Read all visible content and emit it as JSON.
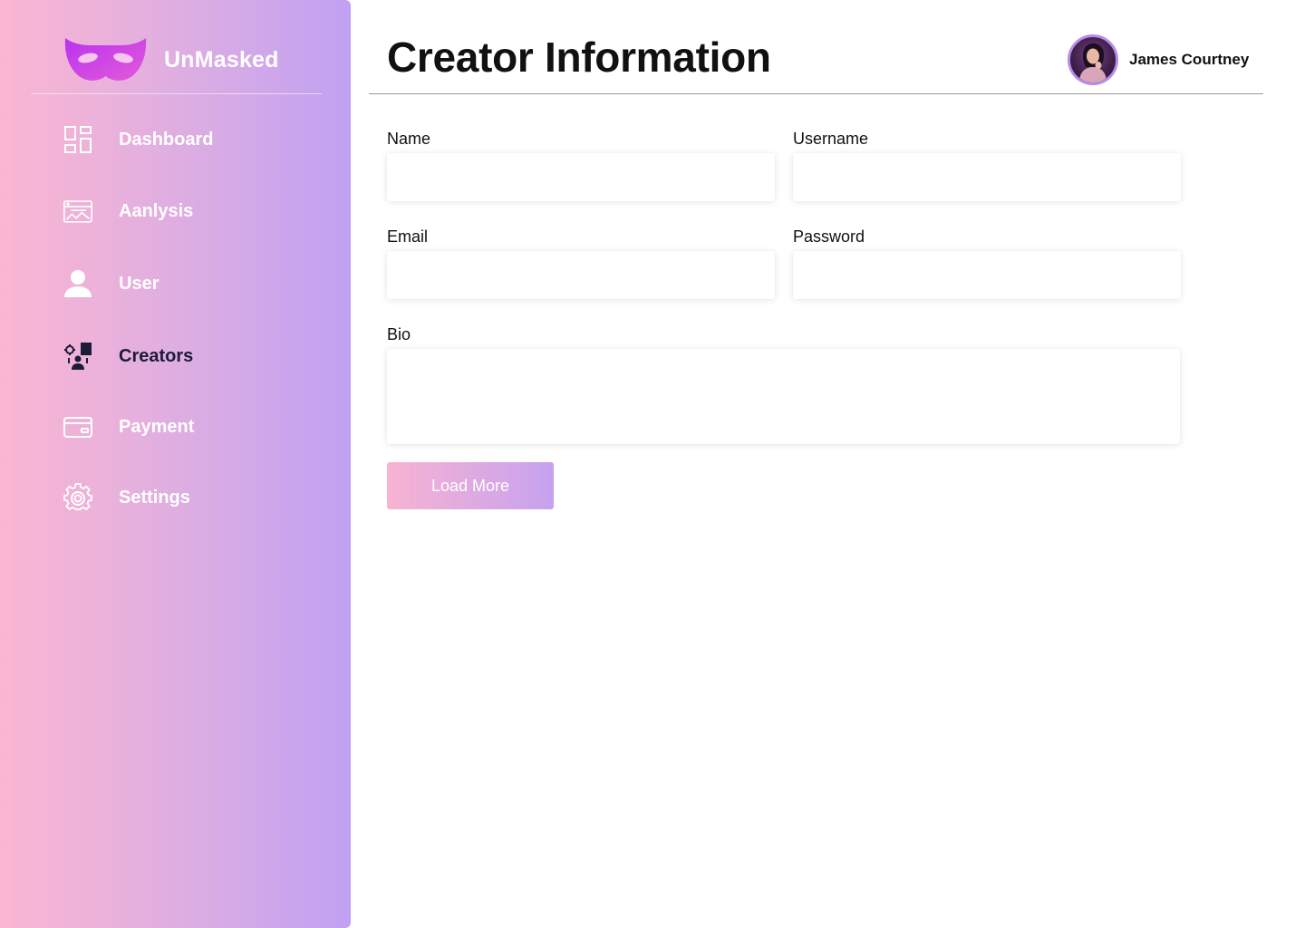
{
  "brand": {
    "name": "UnMasked",
    "logo_icon": "mask-icon",
    "logo_colors": [
      "#b833f0",
      "#e35ad8"
    ]
  },
  "sidebar": {
    "items": [
      {
        "label": "Dashboard",
        "icon": "dashboard-grid-icon",
        "active": false
      },
      {
        "label": "Aanlysis",
        "icon": "analysis-chart-icon",
        "active": false
      },
      {
        "label": "User",
        "icon": "user-icon",
        "active": false
      },
      {
        "label": "Creators",
        "icon": "creators-icon",
        "active": true
      },
      {
        "label": "Payment",
        "icon": "credit-card-icon",
        "active": false
      },
      {
        "label": "Settings",
        "icon": "gear-icon",
        "active": false
      }
    ]
  },
  "header": {
    "title": "Creator Information",
    "user_name": "James Courtney"
  },
  "form": {
    "name_label": "Name",
    "name_value": "",
    "username_label": "Username",
    "username_value": "",
    "email_label": "Email",
    "email_value": "",
    "password_label": "Password",
    "password_value": "",
    "bio_label": "Bio",
    "bio_value": "",
    "load_more_label": "Load More"
  },
  "colors": {
    "sidebar_gradient_start": "#fbb6d1",
    "sidebar_gradient_end": "#c0a1f2",
    "active_nav_text": "#1b1b3a",
    "button_gradient_start": "#f8b3d2",
    "button_gradient_end": "#c6a2ef"
  }
}
